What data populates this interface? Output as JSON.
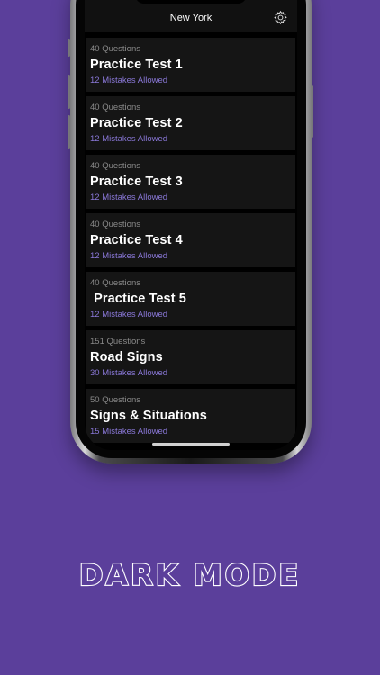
{
  "header": {
    "title": "New York",
    "settings_icon": "gear-icon"
  },
  "tests": [
    {
      "questions": "40 Questions",
      "title": "Practice Test 1",
      "mistakes": "12 Mistakes Allowed"
    },
    {
      "questions": "40 Questions",
      "title": "Practice Test 2",
      "mistakes": "12 Mistakes Allowed"
    },
    {
      "questions": "40 Questions",
      "title": "Practice Test 3",
      "mistakes": "12 Mistakes Allowed"
    },
    {
      "questions": "40 Questions",
      "title": "Practice Test 4",
      "mistakes": "12 Mistakes Allowed"
    },
    {
      "questions": "40 Questions",
      "title": " Practice Test 5",
      "mistakes": "12 Mistakes Allowed"
    },
    {
      "questions": "151 Questions",
      "title": "Road Signs",
      "mistakes": "30 Mistakes Allowed"
    },
    {
      "questions": "50 Questions",
      "title": "Signs & Situations",
      "mistakes": "15 Mistakes Allowed"
    }
  ],
  "caption": "DARK MODE",
  "colors": {
    "background": "#5b3f9b",
    "accent": "#8a78d8",
    "card": "#151515"
  }
}
